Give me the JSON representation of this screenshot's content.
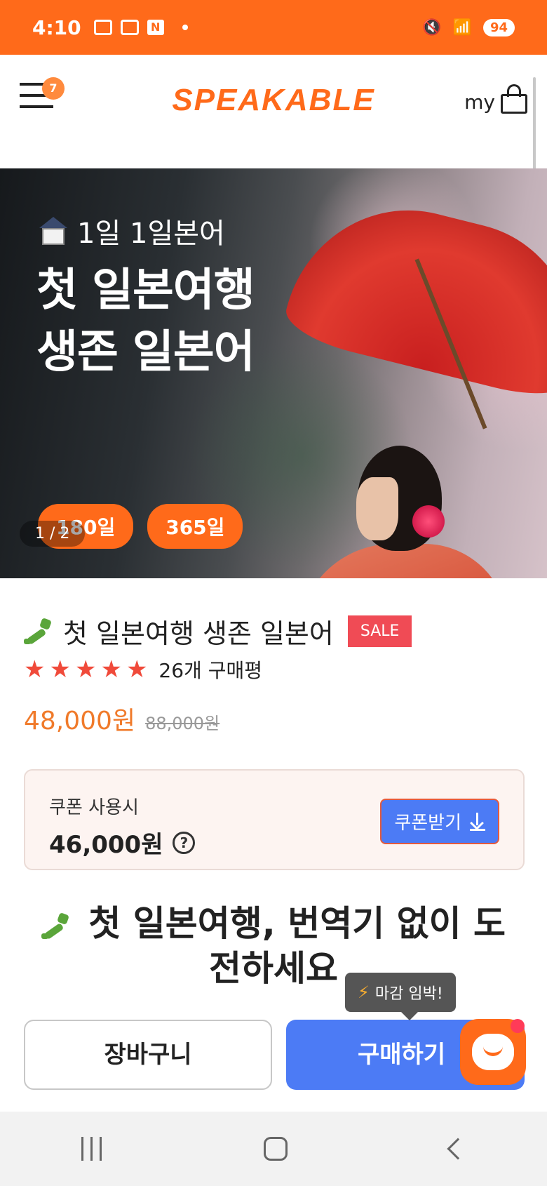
{
  "status_bar": {
    "time": "4:10",
    "battery": "94",
    "notification_icons": [
      "screenshot-icon",
      "card-icon",
      "naver-icon"
    ],
    "right_icons": [
      "mute-icon",
      "wifi-icon",
      "signal-icon",
      "battery-icon"
    ],
    "n_label": "N"
  },
  "header": {
    "menu_badge": "7",
    "logo": "SPEAKABLE",
    "my_label": "my"
  },
  "hero": {
    "subtitle": "1일 1일본어",
    "title_line1": "첫 일본여행",
    "title_line2": "생존 일본어",
    "chips": [
      "180일",
      "365일"
    ],
    "slide_counter": "1 / 2"
  },
  "product": {
    "title": "첫 일본여행 생존 일본어",
    "sale_badge": "SALE",
    "stars": [
      "★",
      "★",
      "★",
      "★",
      "★"
    ],
    "rating": 5,
    "review_count": "26개 구매평",
    "price": "48,000원",
    "original_price": "88,000원"
  },
  "coupon": {
    "label": "쿠폰 사용시",
    "price": "46,000원",
    "help": "?",
    "button_label": "쿠폰받기"
  },
  "section": {
    "heading": "첫 일본여행, 번역기 없이 도전하세요"
  },
  "actions": {
    "cart_label": "장바구니",
    "buy_label": "구매하기",
    "tooltip": "마감 임박!",
    "bolt": "⚡"
  },
  "colors": {
    "brand_orange": "#ff6a1a",
    "buy_blue": "#4c7bf5",
    "sale_red": "#f04b55",
    "star_red": "#f04a3a",
    "price_orange": "#f07a2a"
  }
}
